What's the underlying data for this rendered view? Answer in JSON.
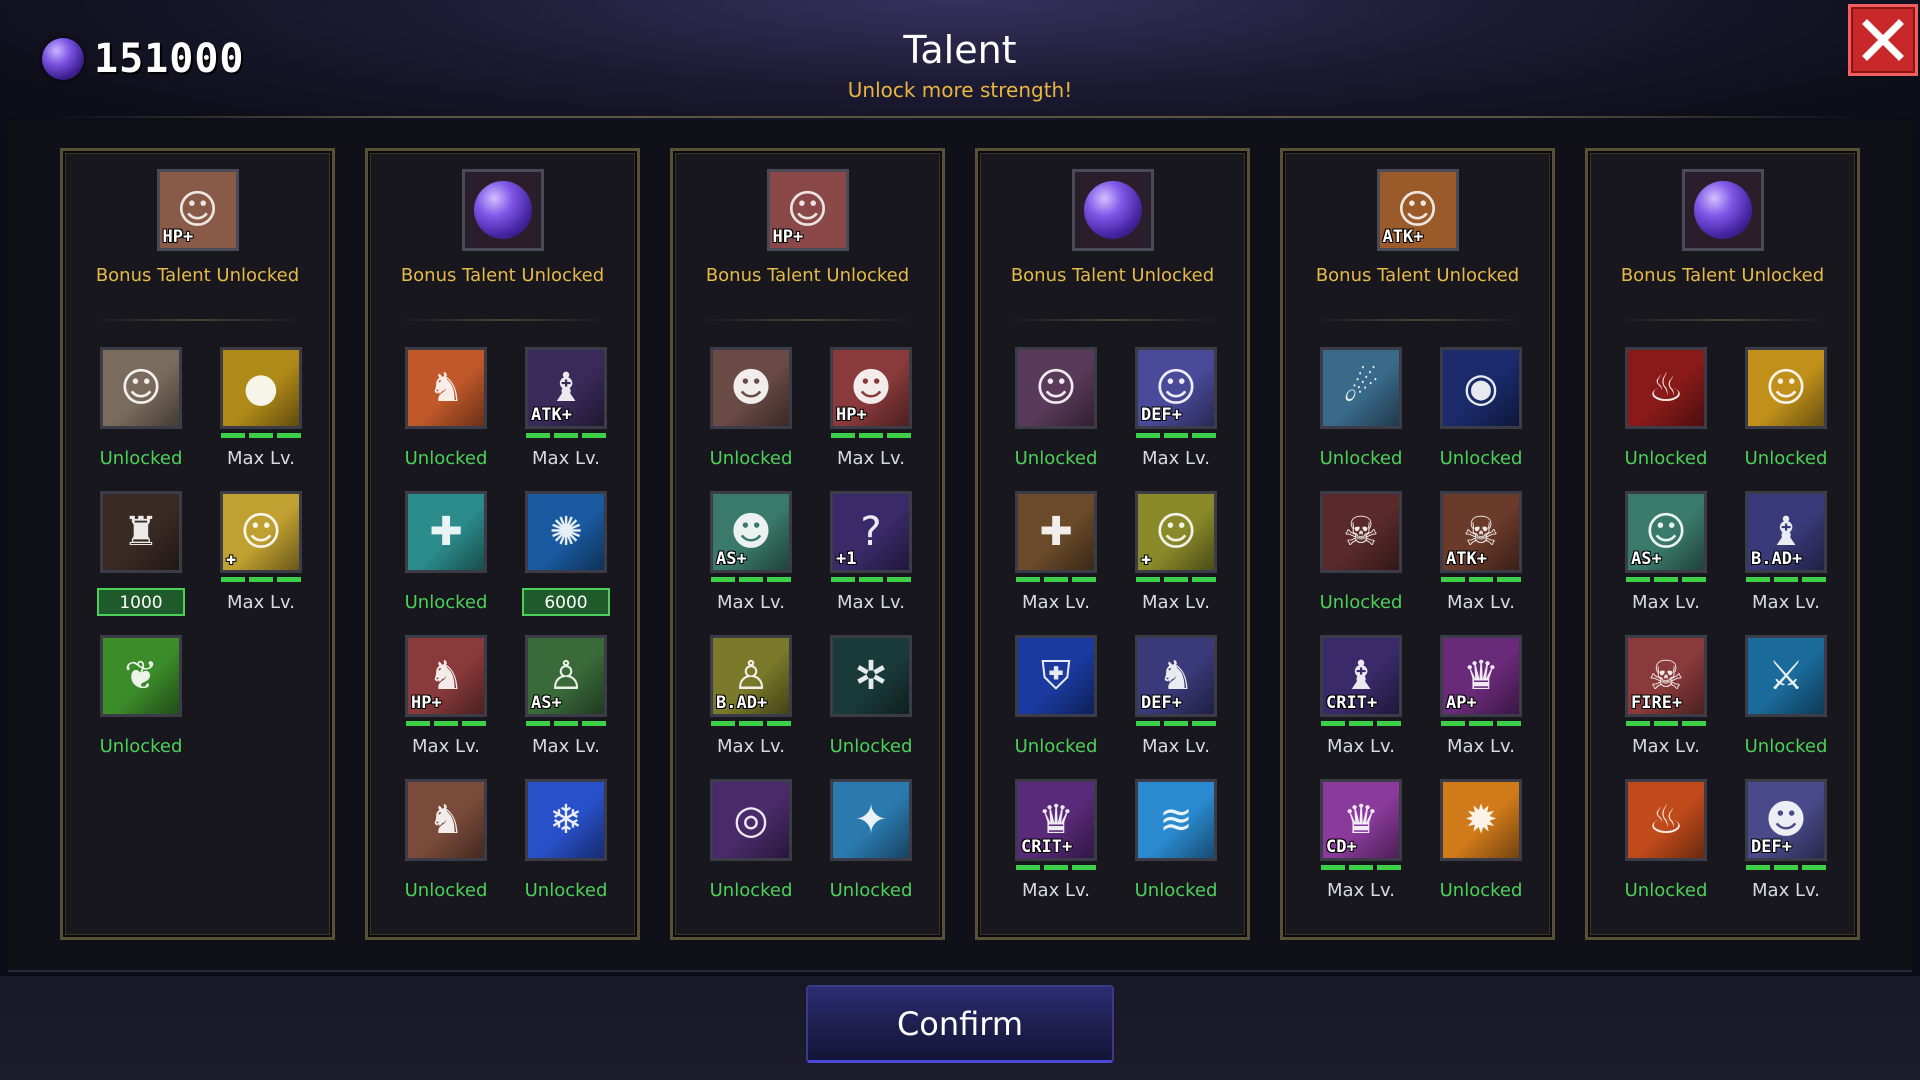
{
  "header": {
    "currency_value": "151000",
    "currency_icon": "purple-orb-icon",
    "title": "Talent",
    "subtitle": "Unlock more strength!",
    "close_icon": "close-icon"
  },
  "colors": {
    "unlocked": "#4cd05a",
    "max": "#d9d9e0",
    "bonus_label": "#e6b94a",
    "subtitle": "#e8b640",
    "close_button": "#c8282a",
    "confirm_button": "#1e1e4e"
  },
  "columns": [
    {
      "bonus": {
        "label": "Bonus Talent Unlocked",
        "icon": "hero-portrait-hp-icon",
        "tag": "HP+",
        "bg": "#8a5a48"
      },
      "talents": [
        {
          "icon": "white-haired-priestess-icon",
          "tag": "",
          "status": "Unlocked",
          "bg": "#7a6c5c",
          "glyph": "☺"
        },
        {
          "icon": "gold-coin-icon",
          "tag": "",
          "status": "Max Lv.",
          "bg": "#b08a18",
          "glyph": "●",
          "bar": true
        },
        {
          "icon": "horned-potion-icon",
          "tag": "",
          "status": "",
          "cost": "1000",
          "bg": "#3a2a24",
          "glyph": "♜"
        },
        {
          "icon": "priestess-heal-icon",
          "tag": "✚",
          "status": "Max Lv.",
          "bg": "#c0a030",
          "glyph": "☺",
          "bar": true
        },
        {
          "icon": "green-leaf-icon",
          "tag": "",
          "status": "Unlocked",
          "bg": "#3c8c2a",
          "glyph": "❦"
        }
      ]
    },
    {
      "bonus": {
        "label": "Bonus Talent Unlocked",
        "icon": "purple-orb-icon",
        "tag": "",
        "bg": "#1e1a34"
      },
      "talents": [
        {
          "icon": "armored-knight-icon",
          "tag": "",
          "status": "Unlocked",
          "bg": "#c0582a",
          "glyph": "♞"
        },
        {
          "icon": "dark-wizard-atk-icon",
          "tag": "ATK+",
          "status": "Max Lv.",
          "bg": "#3a2a5a",
          "glyph": "♝",
          "bar": true
        },
        {
          "icon": "green-cross-shield-icon",
          "tag": "",
          "status": "Unlocked",
          "bg": "#2c8c8c",
          "glyph": "✚"
        },
        {
          "icon": "blue-vortex-icon",
          "tag": "",
          "status": "",
          "cost": "6000",
          "bg": "#1a5aa0",
          "glyph": "✺"
        },
        {
          "icon": "knight-hp-icon",
          "tag": "HP+",
          "status": "Max Lv.",
          "bg": "#8a3a3a",
          "glyph": "♞",
          "bar": true
        },
        {
          "icon": "elf-archer-as-icon",
          "tag": "AS+",
          "status": "Max Lv.",
          "bg": "#3a6a3a",
          "glyph": "♙",
          "bar": true
        },
        {
          "icon": "knight-shield-icon",
          "tag": "",
          "status": "Unlocked",
          "bg": "#7a4a3a",
          "glyph": "♞"
        },
        {
          "icon": "snowflake-icon",
          "tag": "",
          "status": "Unlocked",
          "bg": "#2850c8",
          "glyph": "❄"
        }
      ]
    },
    {
      "bonus": {
        "label": "Bonus Talent Unlocked",
        "icon": "warrior-duo-hp-icon",
        "tag": "HP+",
        "bg": "#8a4848"
      },
      "talents": [
        {
          "icon": "bald-warrior-icon",
          "tag": "",
          "status": "Unlocked",
          "bg": "#6a4a44",
          "glyph": "☻"
        },
        {
          "icon": "bald-warrior-hp-icon",
          "tag": "HP+",
          "status": "Max Lv.",
          "bg": "#8a3a3a",
          "glyph": "☻",
          "bar": true
        },
        {
          "icon": "bald-warrior-as-icon",
          "tag": "AS+",
          "status": "Max Lv.",
          "bg": "#3a7a6a",
          "glyph": "☻",
          "bar": true
        },
        {
          "icon": "mystery-box-icon",
          "tag": "+1",
          "status": "Max Lv.",
          "bg": "#3a2a6a",
          "glyph": "?",
          "bar": true
        },
        {
          "icon": "elf-archer-bad-icon",
          "tag": "B.AD+",
          "status": "Max Lv.",
          "bg": "#7a7a2a",
          "glyph": "♙",
          "bar": true
        },
        {
          "icon": "cyan-spiral-icon",
          "tag": "",
          "status": "Unlocked",
          "bg": "#1a3a3a",
          "glyph": "✲"
        },
        {
          "icon": "purple-sigil-icon",
          "tag": "",
          "status": "Unlocked",
          "bg": "#4a2a6a",
          "glyph": "◎"
        },
        {
          "icon": "ice-slash-icon",
          "tag": "",
          "status": "Unlocked",
          "bg": "#2a7ab0",
          "glyph": "✦"
        }
      ]
    },
    {
      "bonus": {
        "label": "Bonus Talent Unlocked",
        "icon": "purple-orb-icon",
        "tag": "",
        "bg": "#1e1a34"
      },
      "talents": [
        {
          "icon": "pink-haired-girl-icon",
          "tag": "",
          "status": "Unlocked",
          "bg": "#5a3a5a",
          "glyph": "☺"
        },
        {
          "icon": "pink-haired-girl-def-icon",
          "tag": "DEF+",
          "status": "Max Lv.",
          "bg": "#4a4a9a",
          "glyph": "☺",
          "bar": true
        },
        {
          "icon": "holy-book-icon",
          "tag": "",
          "status": "Max Lv.",
          "bg": "#6a4a2a",
          "glyph": "✚",
          "bar": true
        },
        {
          "icon": "pink-haired-girl-heal-icon",
          "tag": "✚",
          "status": "Max Lv.",
          "bg": "#8a8a2a",
          "glyph": "☺",
          "bar": true
        },
        {
          "icon": "blue-shield-emblem-icon",
          "tag": "",
          "status": "Unlocked",
          "bg": "#1a3aa0",
          "glyph": "⛨"
        },
        {
          "icon": "knight-def-icon",
          "tag": "DEF+",
          "status": "Max Lv.",
          "bg": "#3a3a7a",
          "glyph": "♞",
          "bar": true
        },
        {
          "icon": "witch-crit-icon",
          "tag": "CRIT+",
          "status": "Max Lv.",
          "bg": "#5a2a7a",
          "glyph": "♛",
          "bar": true
        },
        {
          "icon": "water-splash-icon",
          "tag": "",
          "status": "Unlocked",
          "bg": "#2a8ad0",
          "glyph": "≋"
        }
      ]
    },
    {
      "bonus": {
        "label": "Bonus Talent Unlocked",
        "icon": "pirate-duo-atk-icon",
        "tag": "ATK+",
        "bg": "#9a5a2a"
      },
      "talents": [
        {
          "icon": "meteor-strike-icon",
          "tag": "",
          "status": "Unlocked",
          "bg": "#3a6a8a",
          "glyph": "☄"
        },
        {
          "icon": "dragon-eye-icon",
          "tag": "",
          "status": "Unlocked",
          "bg": "#1a2a6a",
          "glyph": "◉"
        },
        {
          "icon": "pirate-captain-icon",
          "tag": "",
          "status": "Unlocked",
          "bg": "#5a2a2a",
          "glyph": "☠"
        },
        {
          "icon": "pirate-captain-atk-icon",
          "tag": "ATK+",
          "status": "Max Lv.",
          "bg": "#6a3a2a",
          "glyph": "☠",
          "bar": true
        },
        {
          "icon": "dark-wizard-crit-icon",
          "tag": "CRIT+",
          "status": "Max Lv.",
          "bg": "#3a2a6a",
          "glyph": "♝",
          "bar": true
        },
        {
          "icon": "witch-ap-icon",
          "tag": "AP+",
          "status": "Max Lv.",
          "bg": "#6a2a7a",
          "glyph": "♛",
          "bar": true
        },
        {
          "icon": "witch-cd-icon",
          "tag": "CD+",
          "status": "Max Lv.",
          "bg": "#8a3a9a",
          "glyph": "♛",
          "bar": true
        },
        {
          "icon": "fireball-icon",
          "tag": "",
          "status": "Unlocked",
          "bg": "#d07a1a",
          "glyph": "✹"
        }
      ]
    },
    {
      "bonus": {
        "label": "Bonus Talent Unlocked",
        "icon": "purple-orb-icon",
        "tag": "",
        "bg": "#1e1a34"
      },
      "talents": [
        {
          "icon": "fire-demon-icon",
          "tag": "",
          "status": "Unlocked",
          "bg": "#8a1a1a",
          "glyph": "♨"
        },
        {
          "icon": "priestess-gold-icon",
          "tag": "",
          "status": "Unlocked",
          "bg": "#c0901a",
          "glyph": "☺"
        },
        {
          "icon": "priestess-as-icon",
          "tag": "AS+",
          "status": "Max Lv.",
          "bg": "#3a7a6a",
          "glyph": "☺",
          "bar": true
        },
        {
          "icon": "dark-wizard-bad-icon",
          "tag": "B.AD+",
          "status": "Max Lv.",
          "bg": "#3a3a7a",
          "glyph": "♝",
          "bar": true
        },
        {
          "icon": "pirate-fire-icon",
          "tag": "FIRE+",
          "status": "Max Lv.",
          "bg": "#8a3a3a",
          "glyph": "☠",
          "bar": true
        },
        {
          "icon": "ice-sword-icon",
          "tag": "",
          "status": "Unlocked",
          "bg": "#1a6a9a",
          "glyph": "⚔"
        },
        {
          "icon": "fire-dragon-icon",
          "tag": "",
          "status": "Unlocked",
          "bg": "#c04a1a",
          "glyph": "♨"
        },
        {
          "icon": "bald-warrior-def-icon",
          "tag": "DEF+",
          "status": "Max Lv.",
          "bg": "#4a4a8a",
          "glyph": "☻",
          "bar": true
        }
      ]
    }
  ],
  "footer": {
    "confirm_label": "Confirm"
  }
}
